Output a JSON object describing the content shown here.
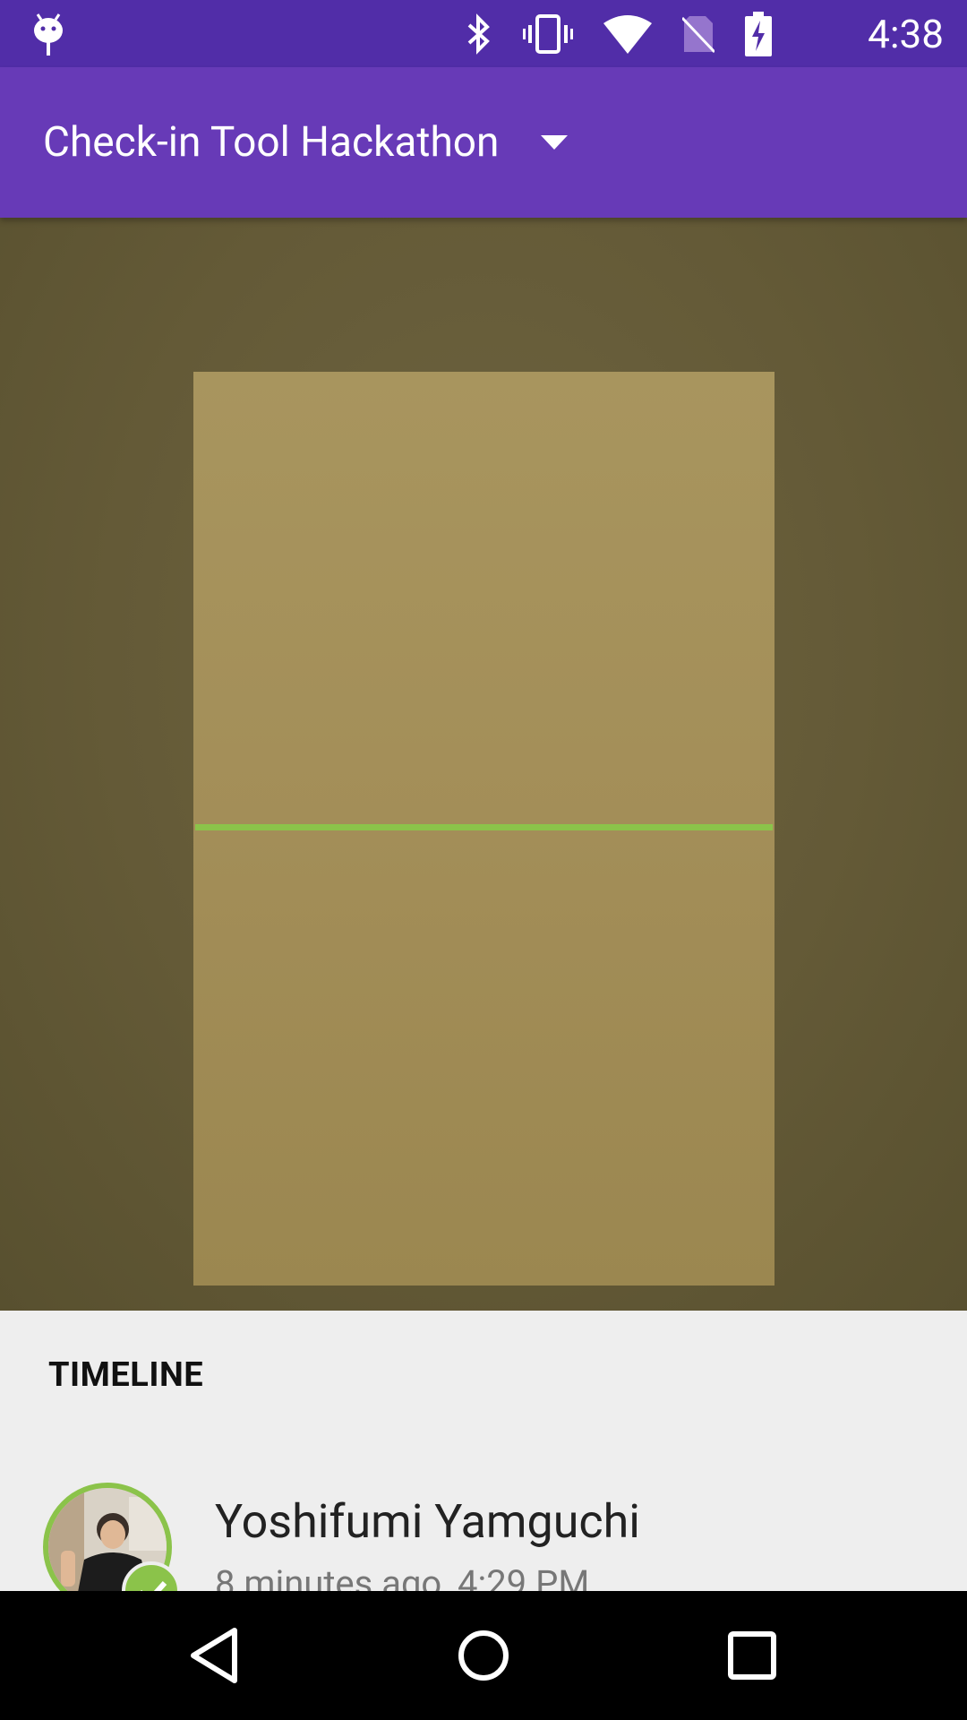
{
  "status_bar": {
    "time": "4:38",
    "icons": [
      "android-debug-icon",
      "bluetooth-icon",
      "vibrate-icon",
      "wifi-icon",
      "no-sim-icon",
      "battery-charging-icon"
    ]
  },
  "app_bar": {
    "title": "Check-in Tool Hackathon",
    "dropdown_icon": "dropdown-caret-icon"
  },
  "timeline": {
    "heading": "TIMELINE",
    "entries": [
      {
        "name": "Yoshifumi Yamguchi",
        "time": "8 minutes ago, 4:29 PM",
        "checked_in": true
      }
    ]
  },
  "nav_bar": {
    "buttons": [
      "back-icon",
      "home-icon",
      "recents-icon"
    ]
  },
  "colors": {
    "status_bar": "#512DA8",
    "app_bar": "#673AB7",
    "scan_line": "#8BC34A",
    "sheet": "#EEEEEE"
  }
}
